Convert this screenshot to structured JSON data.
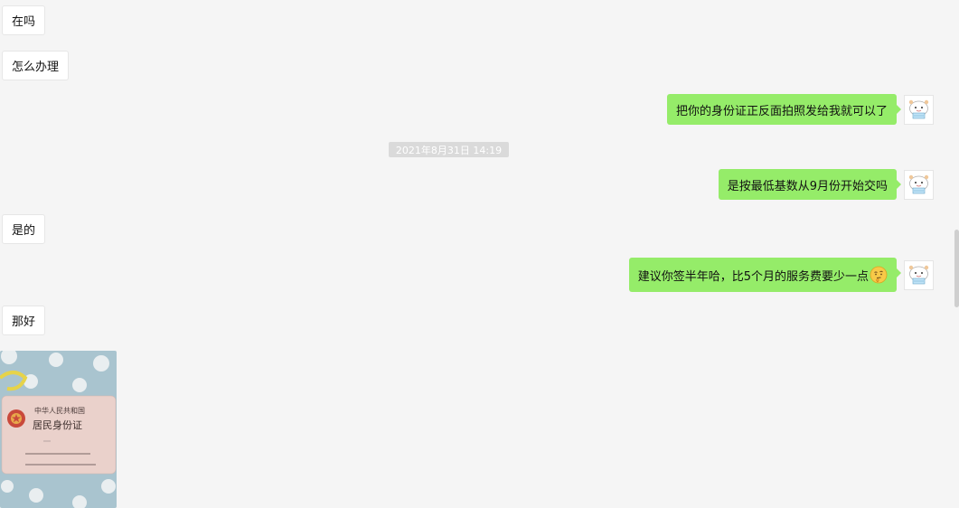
{
  "messages": {
    "m1": "在吗",
    "m2": "怎么办理",
    "m3": "把你的身份证正反面拍照发给我就可以了",
    "time": "2021年8月31日 14:19",
    "m4": "是按最低基数从9月份开始交吗",
    "m5": "是的",
    "m6": "建议你签半年哈，比5个月的服务费要少一点",
    "m7": "那好"
  },
  "id_card": {
    "line1": "中华人民共和国",
    "line2": "居民身份证"
  },
  "colors": {
    "sent_bubble": "#95ec69",
    "received_bubble": "#ffffff",
    "background": "#f5f5f5"
  },
  "icons": {
    "emoji": "thinking-face-emoji",
    "avatar": "cartoon-cat-avatar"
  }
}
